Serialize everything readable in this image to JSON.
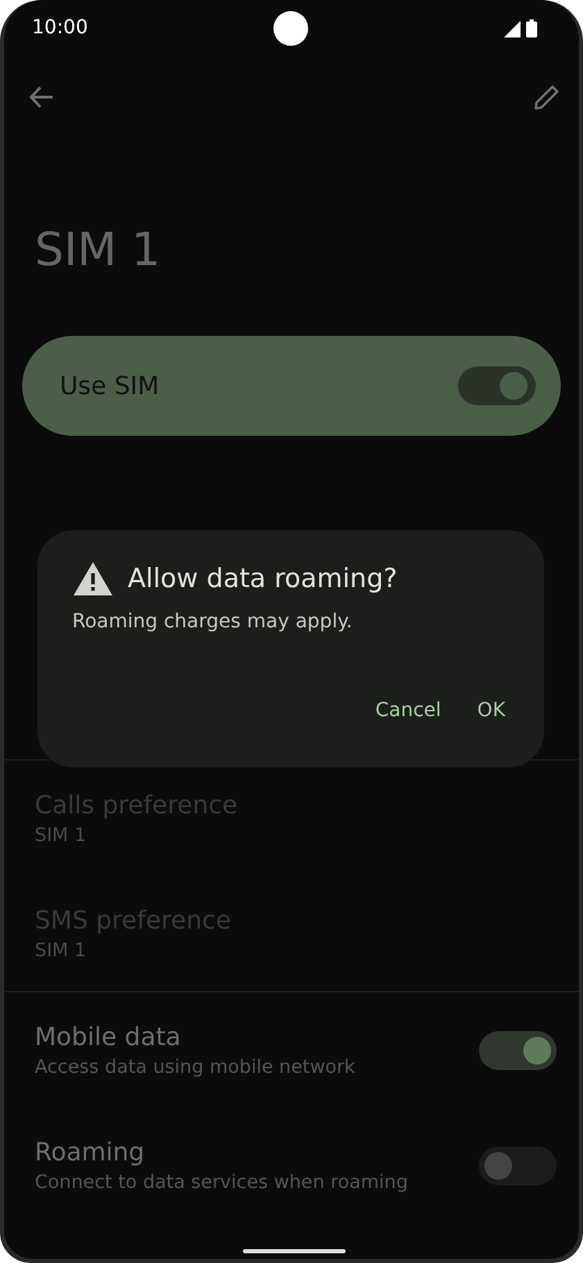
{
  "status_bar": {
    "time": "10:00"
  },
  "title": "SIM 1",
  "use_sim": {
    "label": "Use SIM",
    "on": true
  },
  "preferences": [
    {
      "title": "Calls preference",
      "summary": "SIM 1",
      "disabled": true
    },
    {
      "title": "SMS preference",
      "summary": "SIM 1",
      "disabled": true
    }
  ],
  "toggles": [
    {
      "title": "Mobile data",
      "summary": "Access data using mobile network",
      "on": true
    },
    {
      "title": "Roaming",
      "summary": "Connect to data services when roaming",
      "on": false
    }
  ],
  "dialog": {
    "title": "Allow data roaming?",
    "message": "Roaming charges may apply.",
    "buttons": [
      "Cancel",
      "OK"
    ]
  }
}
